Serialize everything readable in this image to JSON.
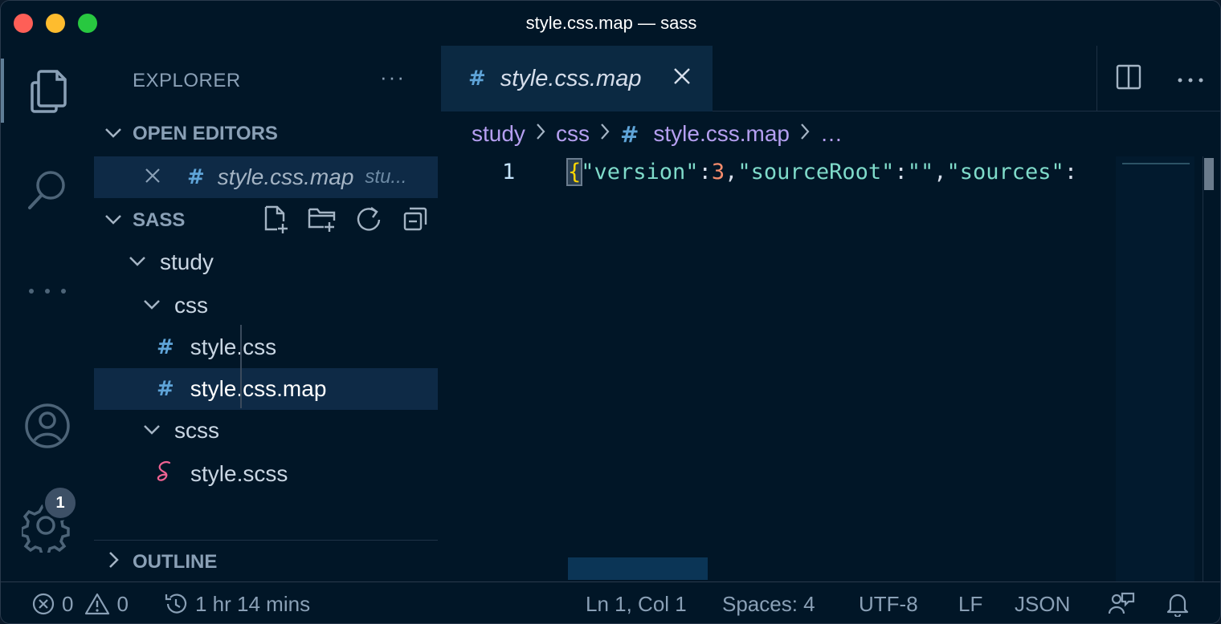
{
  "window": {
    "title": "style.css.map — sass"
  },
  "activity_bar": {
    "settings_badge": "1"
  },
  "sidebar": {
    "title": "EXPLORER",
    "more": "···",
    "open_editors": {
      "label": "OPEN EDITORS",
      "items": [
        {
          "name": "style.css.map",
          "path": "stu..."
        }
      ]
    },
    "workspace": {
      "label": "SASS",
      "tree": [
        {
          "label": "study"
        },
        {
          "label": "css"
        },
        {
          "label": "style.css"
        },
        {
          "label": "style.css.map"
        },
        {
          "label": "scss"
        },
        {
          "label": "style.scss"
        }
      ]
    },
    "outline": {
      "label": "OUTLINE"
    }
  },
  "editor": {
    "tab": {
      "label": "style.css.map"
    },
    "breadcrumbs": [
      "study",
      "css",
      "style.css.map",
      "…"
    ],
    "line_number": "1",
    "code": {
      "t1": "\"version\"",
      "t2": ":",
      "t3": "3",
      "t4": ",",
      "t5": "\"sourceRoot\"",
      "t6": ":",
      "t7": "\"\"",
      "t8": ",",
      "t9": "\"sources\"",
      "t10": ":"
    }
  },
  "statusbar": {
    "errors": "0",
    "warnings": "0",
    "time": "1 hr 14 mins",
    "position": "Ln 1, Col 1",
    "spaces": "Spaces: 4",
    "encoding": "UTF-8",
    "eol": "LF",
    "language": "JSON"
  },
  "colors": {
    "background": "#011627",
    "selection": "#0e2a46",
    "accent_purple": "#b59ff0",
    "hash_blue": "#5fa4d8",
    "string_teal": "#7fdbca",
    "number_orange": "#f78c6c",
    "brace_yellow": "#ffd700",
    "sass_pink": "#f06292"
  }
}
